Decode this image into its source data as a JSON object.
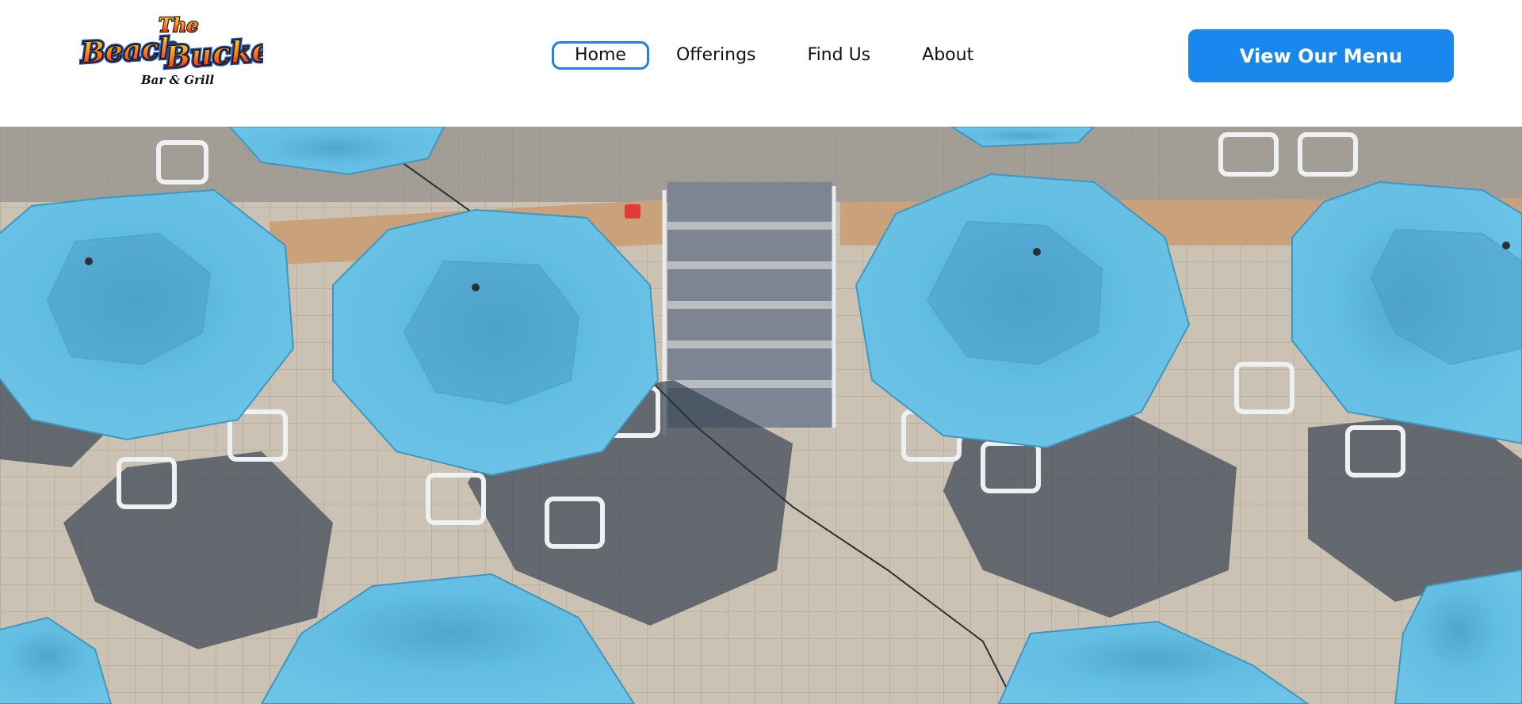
{
  "brand": {
    "logo_alt": "The Beach Bucket Bar & Grill",
    "logo_top_text": "The",
    "logo_main_text": "BeachBucket",
    "logo_sub_text": "Bar & Grill"
  },
  "nav": {
    "items": [
      {
        "label": "Home",
        "active": true
      },
      {
        "label": "Offerings",
        "active": false
      },
      {
        "label": "Find Us",
        "active": false
      },
      {
        "label": "About",
        "active": false
      }
    ]
  },
  "cta": {
    "label": "View Our Menu"
  },
  "colors": {
    "accent": "#1a87ee",
    "umbrella": "#5bb7dc",
    "umbrella_dark": "#3f97c0",
    "patio": "#c8bfb1",
    "shadow": "#3a4654"
  },
  "icons": {
    "logo": "beach-bucket-logo"
  }
}
